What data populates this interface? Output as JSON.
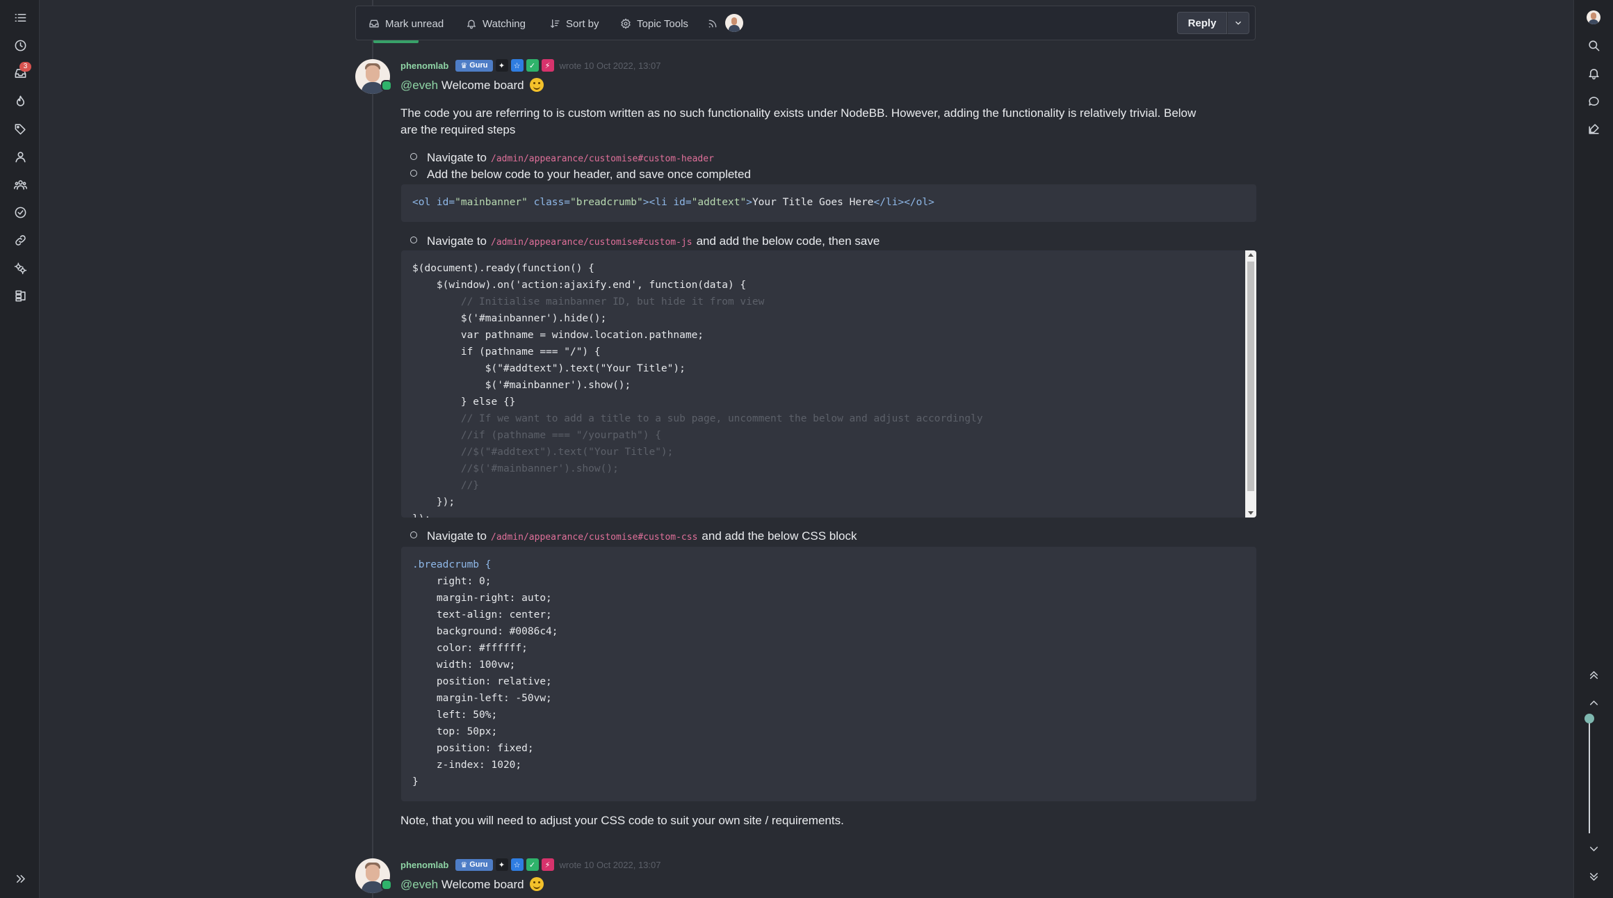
{
  "toolbar": {
    "mark_unread": "Mark unread",
    "watching": "Watching",
    "sort_by": "Sort by",
    "topic_tools": "Topic Tools",
    "reply": "Reply"
  },
  "left_nav": {
    "notification_count": "3",
    "icons": [
      "list-icon",
      "clock-icon",
      "inbox-icon",
      "fire-icon",
      "tags-icon",
      "user-icon",
      "users-icon",
      "check-circle-icon",
      "link-icon",
      "gears-icon",
      "sitemap-icon"
    ]
  },
  "posts": [
    {
      "username": "phenomlab",
      "badge": "Guru",
      "wrote": "wrote 10 Oct 2022, 13:07",
      "mention": "@eveh",
      "greeting": "Welcome board"
    },
    {
      "username": "phenomlab",
      "badge": "Guru",
      "wrote": "wrote 10 Oct 2022, 13:07",
      "mention": "@eveh",
      "greeting": "Welcome board"
    }
  ],
  "content": {
    "intro_line1": "The code you are referring to is custom written as no such functionality exists under NodeBB. However, adding the functionality is relatively trivial. Below",
    "intro_line2": "are the required steps",
    "step1_prefix": "Navigate to",
    "step1_path": "/admin/appearance/customise#custom-header",
    "step1b": "Add the below code to your header, and save once completed",
    "step2_prefix": "Navigate to",
    "step2_path": "/admin/appearance/customise#custom-js",
    "step2_suffix": "and add the below code, then save",
    "step3_prefix": "Navigate to",
    "step3_path": "/admin/appearance/customise#custom-css",
    "step3_suffix": "and add the below CSS block",
    "note": "Note, that you will need to adjust your CSS code to suit your own site / requirements."
  },
  "code_header": {
    "open_ol": "<ol",
    "attr_id": " id=",
    "val_id": "\"mainbanner\"",
    "attr_class": " class=",
    "val_class": "\"breadcrumb\"",
    "close_gt": ">",
    "open_li": "<li",
    "attr_id2": " id=",
    "val_id2": "\"addtext\"",
    "close_gt2": ">",
    "text": "Your Title Goes Here",
    "close_tags": "</li></ol>"
  },
  "code_js": [
    "$(document).ready(function() {",
    "    $(window).on('action:ajaxify.end', function(data) {",
    "        // Initialise mainbanner ID, but hide it from view",
    "        $('#mainbanner').hide();",
    "        var pathname = window.location.pathname;",
    "        if (pathname === \"/\") {",
    "            $(\"#addtext\").text(\"Your Title\");",
    "            $('#mainbanner').show();",
    "        } else {}",
    "        // If we want to add a title to a sub page, uncomment the below and adjust accordingly",
    "        //if (pathname === \"/yourpath\") {",
    "        //$(\"#addtext\").text(\"Your Title\");",
    "        //$('#mainbanner').show();",
    "        //}",
    "    });",
    "});"
  ],
  "code_css": [
    ".breadcrumb {",
    "    right: 0;",
    "    margin-right: auto;",
    "    text-align: center;",
    "    background: #0086c4;",
    "    color: #ffffff;",
    "    width: 100vw;",
    "    position: relative;",
    "    margin-left: -50vw;",
    "    left: 50%;",
    "    top: 50px;",
    "    position: fixed;",
    "    z-index: 1020;",
    "}"
  ],
  "colors": {
    "background": "#292c33",
    "sidebar": "#212328",
    "accent_green": "#38a169",
    "username": "#8fd5a6",
    "guru_badge": "#4e7dc6"
  }
}
